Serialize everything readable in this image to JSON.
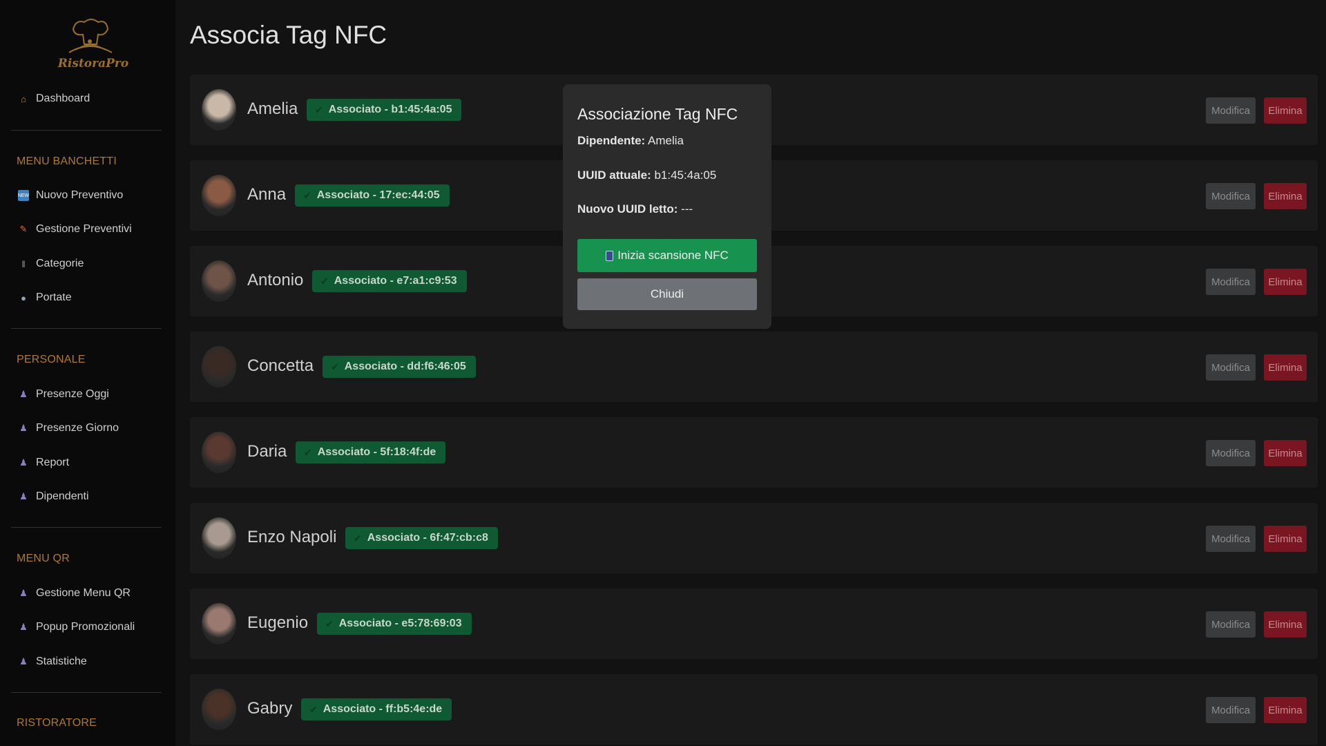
{
  "app": {
    "logo_text": "RistoraPro"
  },
  "page": {
    "title": "Associa Tag NFC"
  },
  "sidebar": {
    "dashboard": "Dashboard",
    "sections": {
      "banchetti": "MENU BANCHETTI",
      "personale": "PERSONALE",
      "qr": "MENU QR",
      "ristoratore": "RISTORATORE"
    },
    "items": {
      "nuovo_preventivo": "Nuovo Preventivo",
      "gestione_preventivi": "Gestione Preventivi",
      "categorie": "Categorie",
      "portate": "Portate",
      "presenze_oggi": "Presenze Oggi",
      "presenze_giorno": "Presenze Giorno",
      "report": "Report",
      "dipendenti": "Dipendenti",
      "gestione_menu_qr": "Gestione Menu QR",
      "popup_promozionali": "Popup Promozionali",
      "statistiche": "Statistiche"
    },
    "icons": {
      "dashboard": "home-icon",
      "nuovo_preventivo": "new-icon",
      "gestione_preventivi": "pencil-icon",
      "categorie": "fork-knife-icon",
      "portate": "dish-icon",
      "person": "person-icon"
    }
  },
  "employees": [
    {
      "name": "Amelia",
      "badge": "Associato - b1:45:4a:05"
    },
    {
      "name": "Anna",
      "badge": "Associato - 17:ec:44:05"
    },
    {
      "name": "Antonio",
      "badge": "Associato - e7:a1:c9:53"
    },
    {
      "name": "Concetta",
      "badge": "Associato - dd:f6:46:05"
    },
    {
      "name": "Daria",
      "badge": "Associato - 5f:18:4f:de"
    },
    {
      "name": "Enzo Napoli",
      "badge": "Associato - 6f:47:cb:c8"
    },
    {
      "name": "Eugenio",
      "badge": "Associato - e5:78:69:03"
    },
    {
      "name": "Gabry",
      "badge": "Associato - ff:b5:4e:de"
    }
  ],
  "row_actions": {
    "edit": "Modifica",
    "delete": "Elimina"
  },
  "modal": {
    "title": "Associazione Tag NFC",
    "employee_label": "Dipendente:",
    "employee_value": "Amelia",
    "uuid_label": "UUID attuale:",
    "uuid_value": "b1:45:4a:05",
    "new_uuid_label": "Nuovo UUID letto:",
    "new_uuid_value": "---",
    "scan_button": "Inizia scansione NFC",
    "close_button": "Chiudi"
  },
  "colors": {
    "background": "#121212",
    "sidebar": "#0a0a0a",
    "accent_section": "#b07a2a",
    "badge_green": "#0f5a33",
    "scan_green": "#17934f",
    "delete_red": "#7a1622"
  }
}
